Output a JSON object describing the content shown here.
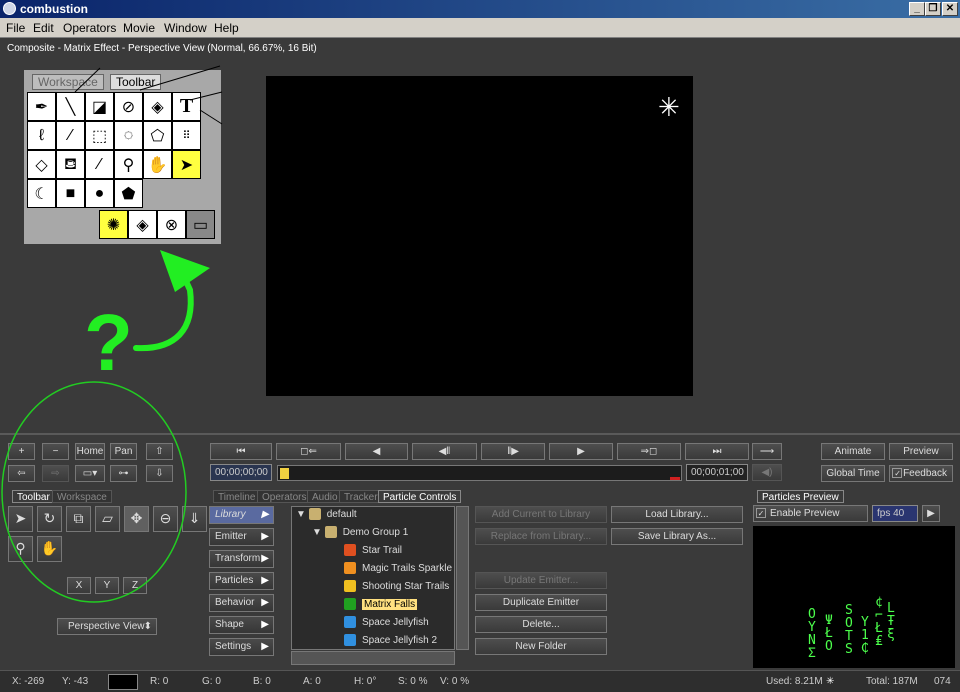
{
  "window": {
    "title": "combustion",
    "controls": [
      "_",
      "❐",
      "✕"
    ]
  },
  "menu": [
    "File",
    "Edit",
    "Operators",
    "Movie",
    "Window",
    "Help"
  ],
  "viewport": {
    "info": "Composite - Matrix Effect - Perspective View (Normal, 66.67%, 16 Bit)"
  },
  "popup": {
    "tabs": [
      "Workspace",
      "Toolbar"
    ]
  },
  "nav": {
    "plus": "+",
    "minus": "−",
    "home": "Home",
    "pan": "Pan"
  },
  "left_panel": {
    "tabs": [
      "Toolbar",
      "Workspace"
    ],
    "axes": [
      "X",
      "Y",
      "Z"
    ],
    "view_select": "Perspective View"
  },
  "transport": {
    "timecode_start": "00;00;00;00",
    "timecode_end": "00;00;01;00",
    "animate": "Animate",
    "preview": "Preview",
    "global_time": "Global Time",
    "feedback": "Feedback"
  },
  "panel_tabs": [
    "Timeline",
    "Operators",
    "Audio",
    "Tracker",
    "Particle Controls"
  ],
  "particle_nav": [
    "Library",
    "Emitter",
    "Transform",
    "Particles",
    "Behavior",
    "Shape",
    "Settings"
  ],
  "tree": {
    "root": "default",
    "group": "Demo Group 1",
    "items": [
      "Star Trail",
      "Magic Trails Sparkle",
      "Shooting Star Trails",
      "Matrix Falls",
      "Space Jellyfish",
      "Space Jellyfish 2"
    ],
    "selected": "Matrix Falls"
  },
  "actions": {
    "add_current": "Add Current to Library",
    "replace": "Replace from Library...",
    "update_emitter": "Update Emitter...",
    "duplicate": "Duplicate Emitter",
    "delete": "Delete...",
    "new_folder": "New Folder",
    "load_library": "Load Library...",
    "save_library": "Save Library As..."
  },
  "particles_preview": {
    "tab": "Particles Preview",
    "enable": "Enable Preview",
    "fps": "fps 40"
  },
  "status": {
    "x": "X: -269",
    "y": "Y: -43",
    "r": "R: 0",
    "g": "G: 0",
    "b": "B: 0",
    "a": "A: 0",
    "h": "H: 0°",
    "s": "S: 0 %",
    "v": "V: 0 %",
    "used": "Used: 8.21M",
    "total": "Total: 187M",
    "frame": "074"
  },
  "annotation": {
    "question": "?"
  },
  "colors": {
    "accent_green": "#22ee22",
    "selection": "#ffe080",
    "tool_highlight": "#ffff40"
  }
}
